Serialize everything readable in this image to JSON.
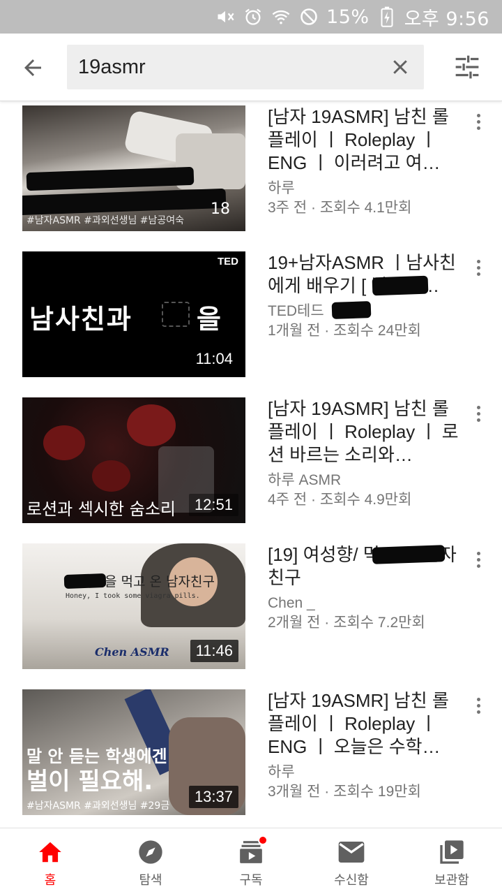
{
  "status_bar": {
    "battery": "15%",
    "time": "오후 9:56"
  },
  "search": {
    "query": "19asmr"
  },
  "results": [
    {
      "title": "[남자 19ASMR] 남친 롤플레이 ㅣ Roleplay ㅣENG ㅣ 이러려고 여…",
      "channel": "하루",
      "stats": "3주 전 · 조회수 4.1만회",
      "duration": "",
      "thumb_caption": "#남자ASMR #과외선생님 #남공여숙"
    },
    {
      "title": "19+남자ASMR ㅣ남사친에게 배우기 [ 남사친…",
      "channel": "TED테드",
      "stats": "1개월 전 · 조회수 24만회",
      "duration": "11:04",
      "thumb_caption": "남사친과",
      "thumb_badge": "TED"
    },
    {
      "title": "[남자 19ASMR] 남친 롤플레이 ㅣ Roleplay ㅣ 로션 바르는 소리와…",
      "channel": "하루 ASMR",
      "stats": "4주 전 · 조회수 4.9만회",
      "duration": "12:51",
      "thumb_caption": "로션과 섹시한 숨소리"
    },
    {
      "title": "[19] 여성향/ 먹고 온 남자친구",
      "channel": "Chen _",
      "stats": "2개월 전 · 조회수 7.2만회",
      "duration": "11:46",
      "thumb_caption": "을 먹고 온 남자친구",
      "thumb_subcaption": "Honey, I took some viagra pills.",
      "thumb_brand": "Chen ASMR"
    },
    {
      "title": "[남자 19ASMR] 남친 롤플레이 ㅣ Roleplay ㅣENG ㅣ 오늘은 수학…",
      "channel": "하루",
      "stats": "3개월 전 · 조회수 19만회",
      "duration": "13:37",
      "thumb_caption": "말 안 듣는 학생에겐",
      "thumb_caption2": "벌이 필요해.",
      "thumb_tags": "#남자ASMR #과외선생님 #29금"
    }
  ],
  "bottom_nav": [
    {
      "label": "홈",
      "icon": "home-icon",
      "active": true
    },
    {
      "label": "탐색",
      "icon": "compass-icon",
      "active": false
    },
    {
      "label": "구독",
      "icon": "subscriptions-icon",
      "active": false
    },
    {
      "label": "수신함",
      "icon": "mail-icon",
      "active": false
    },
    {
      "label": "보관함",
      "icon": "library-icon",
      "active": false
    }
  ],
  "colors": {
    "accent": "#ff0000",
    "status_bar": "#bdbdbd",
    "secondary_text": "#757575"
  }
}
